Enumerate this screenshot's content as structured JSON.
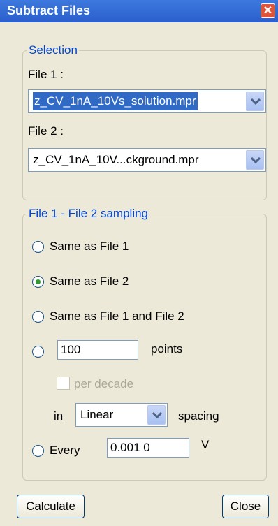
{
  "window": {
    "title": "Subtract Files",
    "close_icon": "✕"
  },
  "selection": {
    "legend": "Selection",
    "file1_label": "File 1 :",
    "file1_value": "z_CV_1nA_10Vs_solution.mpr",
    "file2_label": "File 2 :",
    "file2_value": "z_CV_1nA_10V...ckground.mpr"
  },
  "sampling": {
    "legend": "File 1 - File 2 sampling",
    "option1": "Same as File 1",
    "option2": "Same as File 2",
    "option3": "Same as File 1 and File 2",
    "points_value": "100",
    "points_label": "points",
    "per_decade_label": "per decade",
    "in_label": "in",
    "spacing_value": "Linear",
    "spacing_label": "spacing",
    "every_label": "Every",
    "every_value": "0.001 0",
    "unit_label": "V",
    "selected_option": "Same as File 2"
  },
  "buttons": {
    "calculate": "Calculate",
    "close": "Close"
  }
}
